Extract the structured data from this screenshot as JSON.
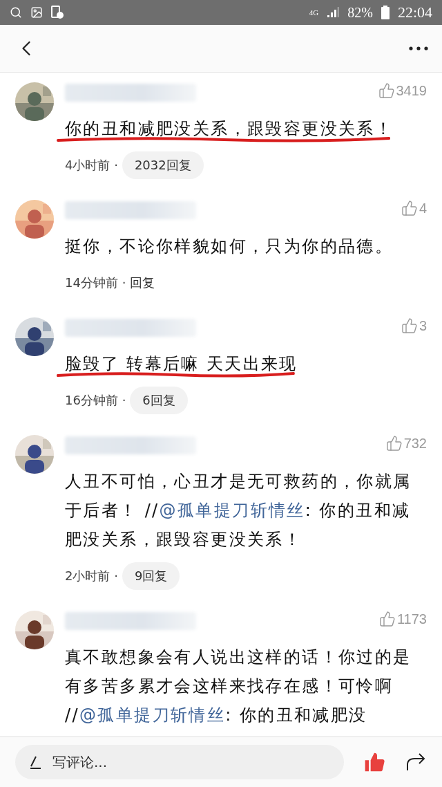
{
  "status_bar": {
    "network": "4G",
    "battery": "82%",
    "time": "22:04"
  },
  "comments": [
    {
      "likes": "3419",
      "underlined": true,
      "segments": [
        {
          "kind": "text",
          "text": "你的丑和减肥没关系，跟毁容更没关系！"
        }
      ],
      "time": "4小时前 ·",
      "replies": {
        "label": "2032回复",
        "pill": true
      }
    },
    {
      "likes": "4",
      "underlined": false,
      "segments": [
        {
          "kind": "text",
          "text": "挺你，不论你样貌如何，只为你的品德。"
        }
      ],
      "time": "14分钟前 ·",
      "replies": {
        "label": "回复",
        "pill": false
      }
    },
    {
      "likes": "3",
      "underlined": true,
      "segments": [
        {
          "kind": "text",
          "text": "脸毁了 转幕后嘛 天天出来现"
        }
      ],
      "time": "16分钟前 ·",
      "replies": {
        "label": "6回复",
        "pill": true
      }
    },
    {
      "likes": "732",
      "underlined": false,
      "segments": [
        {
          "kind": "text",
          "text": "人丑不可怕，心丑才是无可救药的，你就属于后者！ //"
        },
        {
          "kind": "mention",
          "text": "@孤单提刀斩情丝"
        },
        {
          "kind": "text",
          "text": ": 你的丑和减肥没关系，跟毁容更没关系！"
        }
      ],
      "time": "2小时前 ·",
      "replies": {
        "label": "9回复",
        "pill": true
      }
    },
    {
      "likes": "1173",
      "underlined": false,
      "segments": [
        {
          "kind": "text",
          "text": "真不敢想象会有人说出这样的话！你过的是有多苦多累才会这样来找存在感！可怜啊 //"
        },
        {
          "kind": "mention",
          "text": "@孤单提刀斩情丝"
        },
        {
          "kind": "text",
          "text": ": 你的丑和减肥没"
        }
      ]
    }
  ],
  "bottom_bar": {
    "placeholder": "写评论..."
  }
}
